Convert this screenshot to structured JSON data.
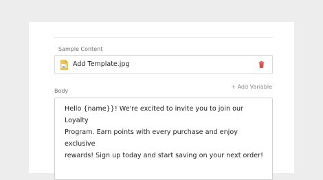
{
  "sample_content": {
    "label": "Sample Content",
    "file": {
      "name": "Add Template.jpg",
      "icon": "image-file-icon",
      "delete_icon": "trash-icon",
      "delete_color": "#d9534f"
    }
  },
  "body": {
    "label": "Body",
    "add_variable": "+ Add Variable",
    "text": "Hello {name}}! We're excited to invite you to join our Loyalty\nProgram. Earn points with every purchase and enjoy exclusive\nrewards! Sign up today and start saving on your next order!"
  }
}
